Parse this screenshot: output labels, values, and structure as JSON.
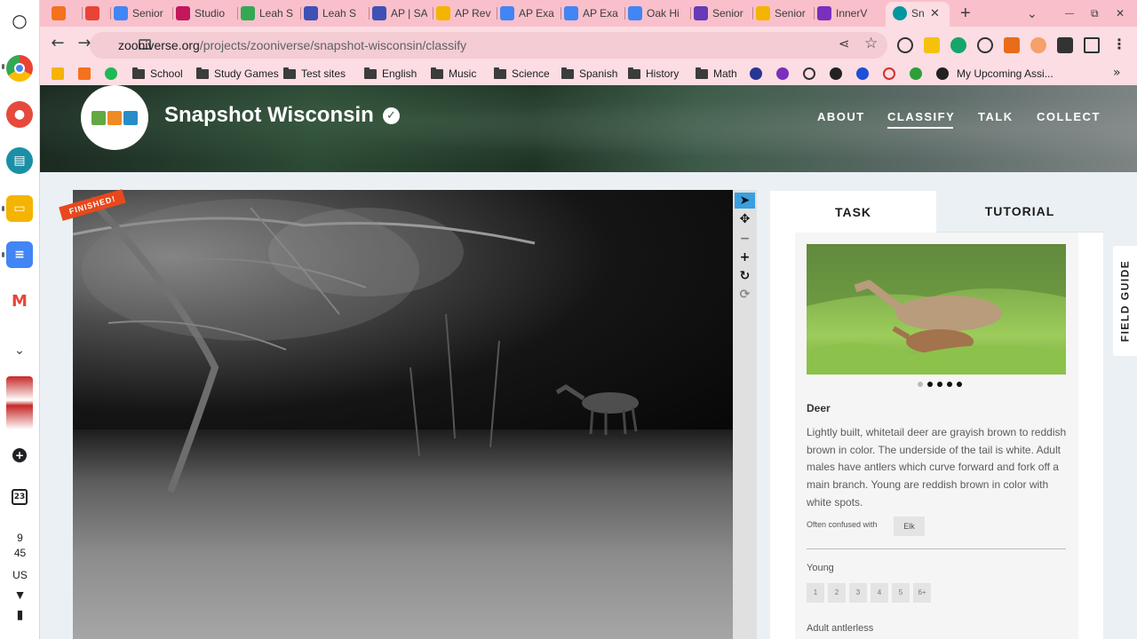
{
  "shelf": {
    "launcher_icon": "launcher-circle-icon",
    "clock_hour": "9",
    "clock_minute": "45",
    "keyboard_layout": "US",
    "calendar_day": "23"
  },
  "tabs": [
    {
      "label": "",
      "icon": "home-icon",
      "color": "#f4711e"
    },
    {
      "label": "",
      "icon": "gmail-icon",
      "color": "#ea4335"
    },
    {
      "label": "Senior",
      "icon": "docs-icon",
      "color": "#4285f4"
    },
    {
      "label": "Studio",
      "icon": "studio-icon",
      "color": "#c2185b"
    },
    {
      "label": "Leah S",
      "icon": "drive-icon",
      "color": "#34a853"
    },
    {
      "label": "Leah S",
      "icon": "app-icon",
      "color": "#3f51b5"
    },
    {
      "label": "AP | SA",
      "icon": "shield-icon",
      "color": "#3f51b5"
    },
    {
      "label": "AP Rev",
      "icon": "slides-icon",
      "color": "#f4b400"
    },
    {
      "label": "AP Exa",
      "icon": "docs-icon",
      "color": "#4285f4"
    },
    {
      "label": "AP Exa",
      "icon": "docs-icon",
      "color": "#4285f4"
    },
    {
      "label": "Oak Hi",
      "icon": "calendar-icon",
      "color": "#4285f4"
    },
    {
      "label": "Senior",
      "icon": "forms-icon",
      "color": "#673ab7"
    },
    {
      "label": "Senior",
      "icon": "slides-icon",
      "color": "#f4b400"
    },
    {
      "label": "InnerV",
      "icon": "dots-icon",
      "color": "#7b2fbe"
    },
    {
      "label": "Sn",
      "icon": "zooniverse-icon",
      "color": "#00979d",
      "active": true
    }
  ],
  "window": {
    "new_tab": "+",
    "dropdown": "⌄",
    "minimize": "—",
    "restore": "⧉",
    "close": "✕",
    "tab_close": "✕"
  },
  "toolbar": {
    "back": "←",
    "forward": "→",
    "reload": "↻",
    "url_host": "zooniverse.org",
    "url_path": "/projects/zooniverse/snapshot-wisconsin/classify"
  },
  "bookmarks": [
    {
      "label": "School",
      "type": "folder"
    },
    {
      "label": "Study Games",
      "type": "folder"
    },
    {
      "label": "Test sites",
      "type": "folder"
    },
    {
      "label": "English",
      "type": "folder"
    },
    {
      "label": "Music",
      "type": "folder"
    },
    {
      "label": "Science",
      "type": "folder"
    },
    {
      "label": "Spanish",
      "type": "folder"
    },
    {
      "label": "History",
      "type": "folder"
    },
    {
      "label": "Math",
      "type": "folder"
    },
    {
      "label": "My Upcoming Assi...",
      "type": "link"
    }
  ],
  "header": {
    "project_title": "Snapshot Wisconsin",
    "nav": [
      "ABOUT",
      "CLASSIFY",
      "TALK",
      "COLLECT"
    ],
    "active_nav": "CLASSIFY"
  },
  "viewer": {
    "badge": "FINISHED!",
    "tools": [
      "pointer-icon",
      "move-icon",
      "zoom-out-icon",
      "zoom-in-icon",
      "rotate-icon",
      "reset-icon"
    ]
  },
  "panel": {
    "tabs": [
      "TASK",
      "TUTORIAL"
    ],
    "carousel_dots": 5,
    "animal_name": "Deer",
    "description": "Lightly built, whitetail deer are grayish brown to reddish brown in color. The underside of the tail is white. Adult males have antlers which curve forward and fork off a main branch. Young are reddish brown in color with white spots.",
    "confused_label": "Often confused with",
    "confused_with": "Elk",
    "question_young": "Young",
    "young_options": [
      "1",
      "2",
      "3",
      "4",
      "5",
      "6+"
    ],
    "question_adult": "Adult antlerless"
  },
  "field_guide": "FIELD GUIDE"
}
